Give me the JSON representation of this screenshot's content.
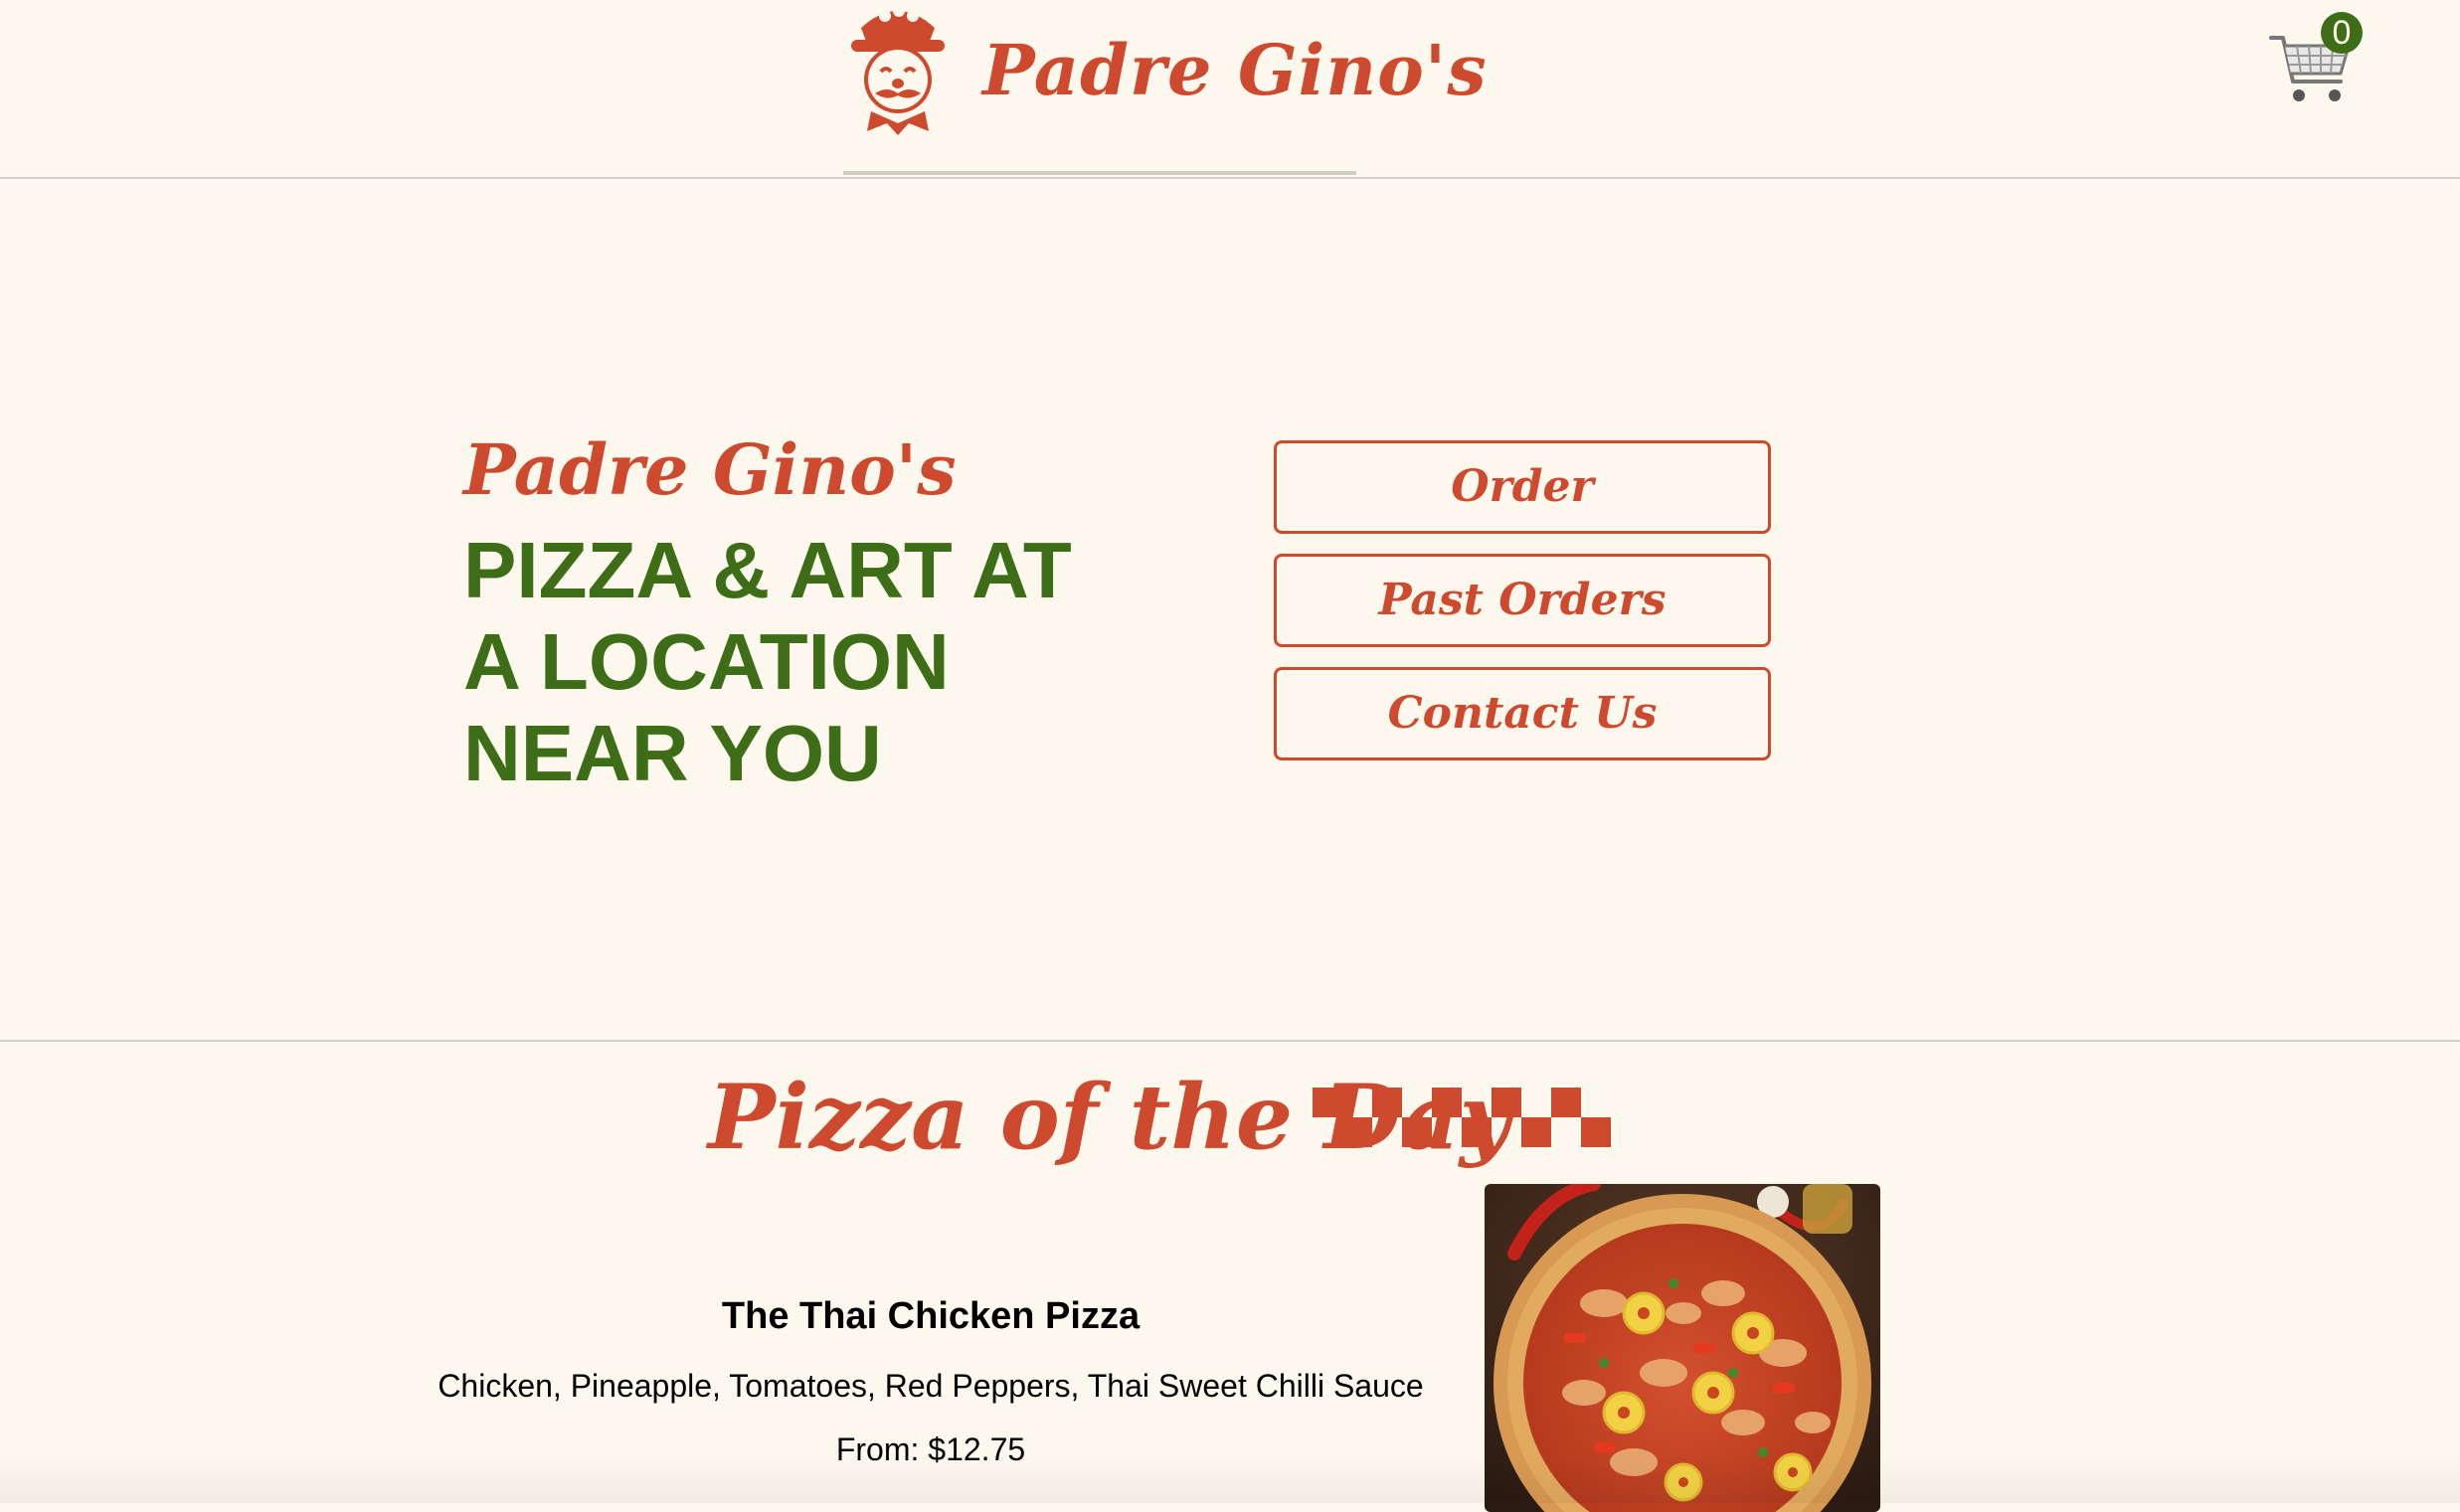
{
  "header": {
    "brand_name": "Padre  Gino's",
    "logo_icon": "chef-mascot-icon",
    "cart": {
      "icon": "shopping-cart-icon",
      "count": "0"
    }
  },
  "hero": {
    "subtitle": "Padre Gino's",
    "title": "PIZZA & ART AT A LOCATION NEAR YOU",
    "buttons": {
      "order": "Order",
      "past_orders": "Past Orders",
      "contact": "Contact Us"
    }
  },
  "pizza_of_the_day": {
    "heading": "Pizza of the Day",
    "decoration": "checkerboard-icon",
    "name": "The Thai Chicken Pizza",
    "description": "Chicken, Pineapple, Tomatoes, Red Peppers, Thai Sweet Chilli Sauce",
    "price": "From: $12.75",
    "image": "pizza-photo"
  },
  "colors": {
    "background": "#fdf8ed",
    "accent_red": "#cd4a2e",
    "accent_green": "#3e6d18",
    "divider": "#d3d0c9"
  }
}
